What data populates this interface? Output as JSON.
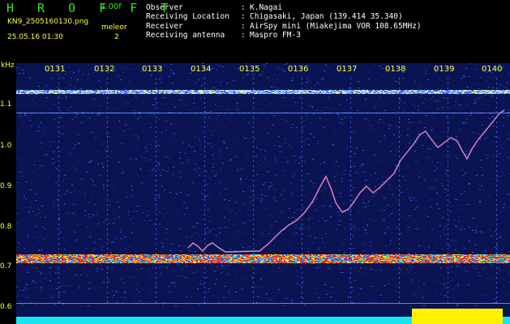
{
  "header": {
    "title": "H R O F F T",
    "version": "1.00f",
    "filename": "KN9_2505160130.png",
    "meteor_label": "meleor",
    "datetime": "25.05.16 01:30",
    "meteor_count": "2",
    "observer_key": "Observer",
    "observer_val": "K.Nagai",
    "location_key": "Receiving Location",
    "location_val": "Chigasaki, Japan (139.414 35.340)",
    "receiver_key": "Receiver",
    "receiver_val": "AirSpy mini (Miakejima VOR 108.65MHz)",
    "antenna_key": "Receiving antenna",
    "antenna_val": "Maspro FM-3",
    "colon": ":"
  },
  "axis": {
    "y_unit": "kHz",
    "y_ticks": [
      "1.1",
      "1.0",
      "0.9",
      "0.8",
      "0.7",
      "0.6"
    ],
    "x_ticks": [
      "0131",
      "0132",
      "0133",
      "0134",
      "0135",
      "0136",
      "0137",
      "0138",
      "0139",
      "0140"
    ]
  },
  "colors": {
    "background": "#000000",
    "title_green": "#35e21f",
    "label_yellow": "#ffff3b",
    "noise_blue": "#1c2f9a",
    "band_red": "#e3311b",
    "bottom_cyan": "#18e5f0",
    "bottom_yellow": "#fff200"
  }
}
